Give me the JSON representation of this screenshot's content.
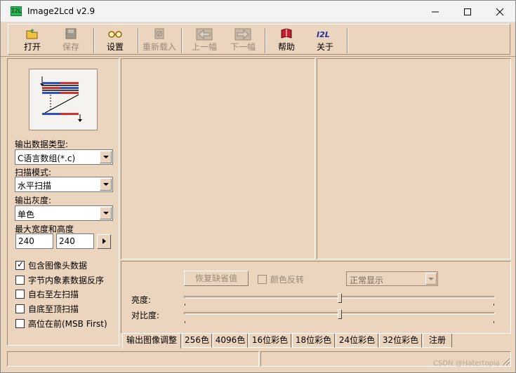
{
  "window": {
    "title": "Image2Lcd v2.9",
    "app_icon_text": "I2L"
  },
  "toolbar": {
    "open": "打开",
    "save": "保存",
    "settings": "设置",
    "reload": "重新载入",
    "prev": "上一幅",
    "next": "下一幅",
    "help": "帮助",
    "about": "关于"
  },
  "left_panel": {
    "output_type_label": "输出数据类型:",
    "output_type_value": "C语言数组(*.c)",
    "scan_mode_label": "扫描模式:",
    "scan_mode_value": "水平扫描",
    "gray_label": "输出灰度:",
    "gray_value": "单色",
    "max_size_label": "最大宽度和高度",
    "width_value": "240",
    "height_value": "240",
    "checkboxes": [
      {
        "label": "包含图像头数据",
        "checked": true
      },
      {
        "label": "字节内象素数据反序",
        "checked": false
      },
      {
        "label": "自右至左扫描",
        "checked": false
      },
      {
        "label": "自底至顶扫描",
        "checked": false
      },
      {
        "label": "高位在前(MSB First)",
        "checked": false
      }
    ]
  },
  "adjust": {
    "restore_button": "恢复缺省值",
    "invert_label": "颜色反转",
    "display_mode_value": "正常显示",
    "brightness_label": "亮度:",
    "contrast_label": "对比度:",
    "brightness_level": 0.5,
    "contrast_level": 0.5
  },
  "tabs": [
    "输出图像调整",
    "256色",
    "4096色",
    "16位彩色",
    "18位彩色",
    "24位彩色",
    "32位彩色",
    "注册"
  ],
  "active_tab": 0,
  "watermark": "CSDN @Hatertopia",
  "colors": {
    "panel_bg": "#ecd5be",
    "accent_blue": "#3050c0",
    "accent_red": "#d03030"
  }
}
